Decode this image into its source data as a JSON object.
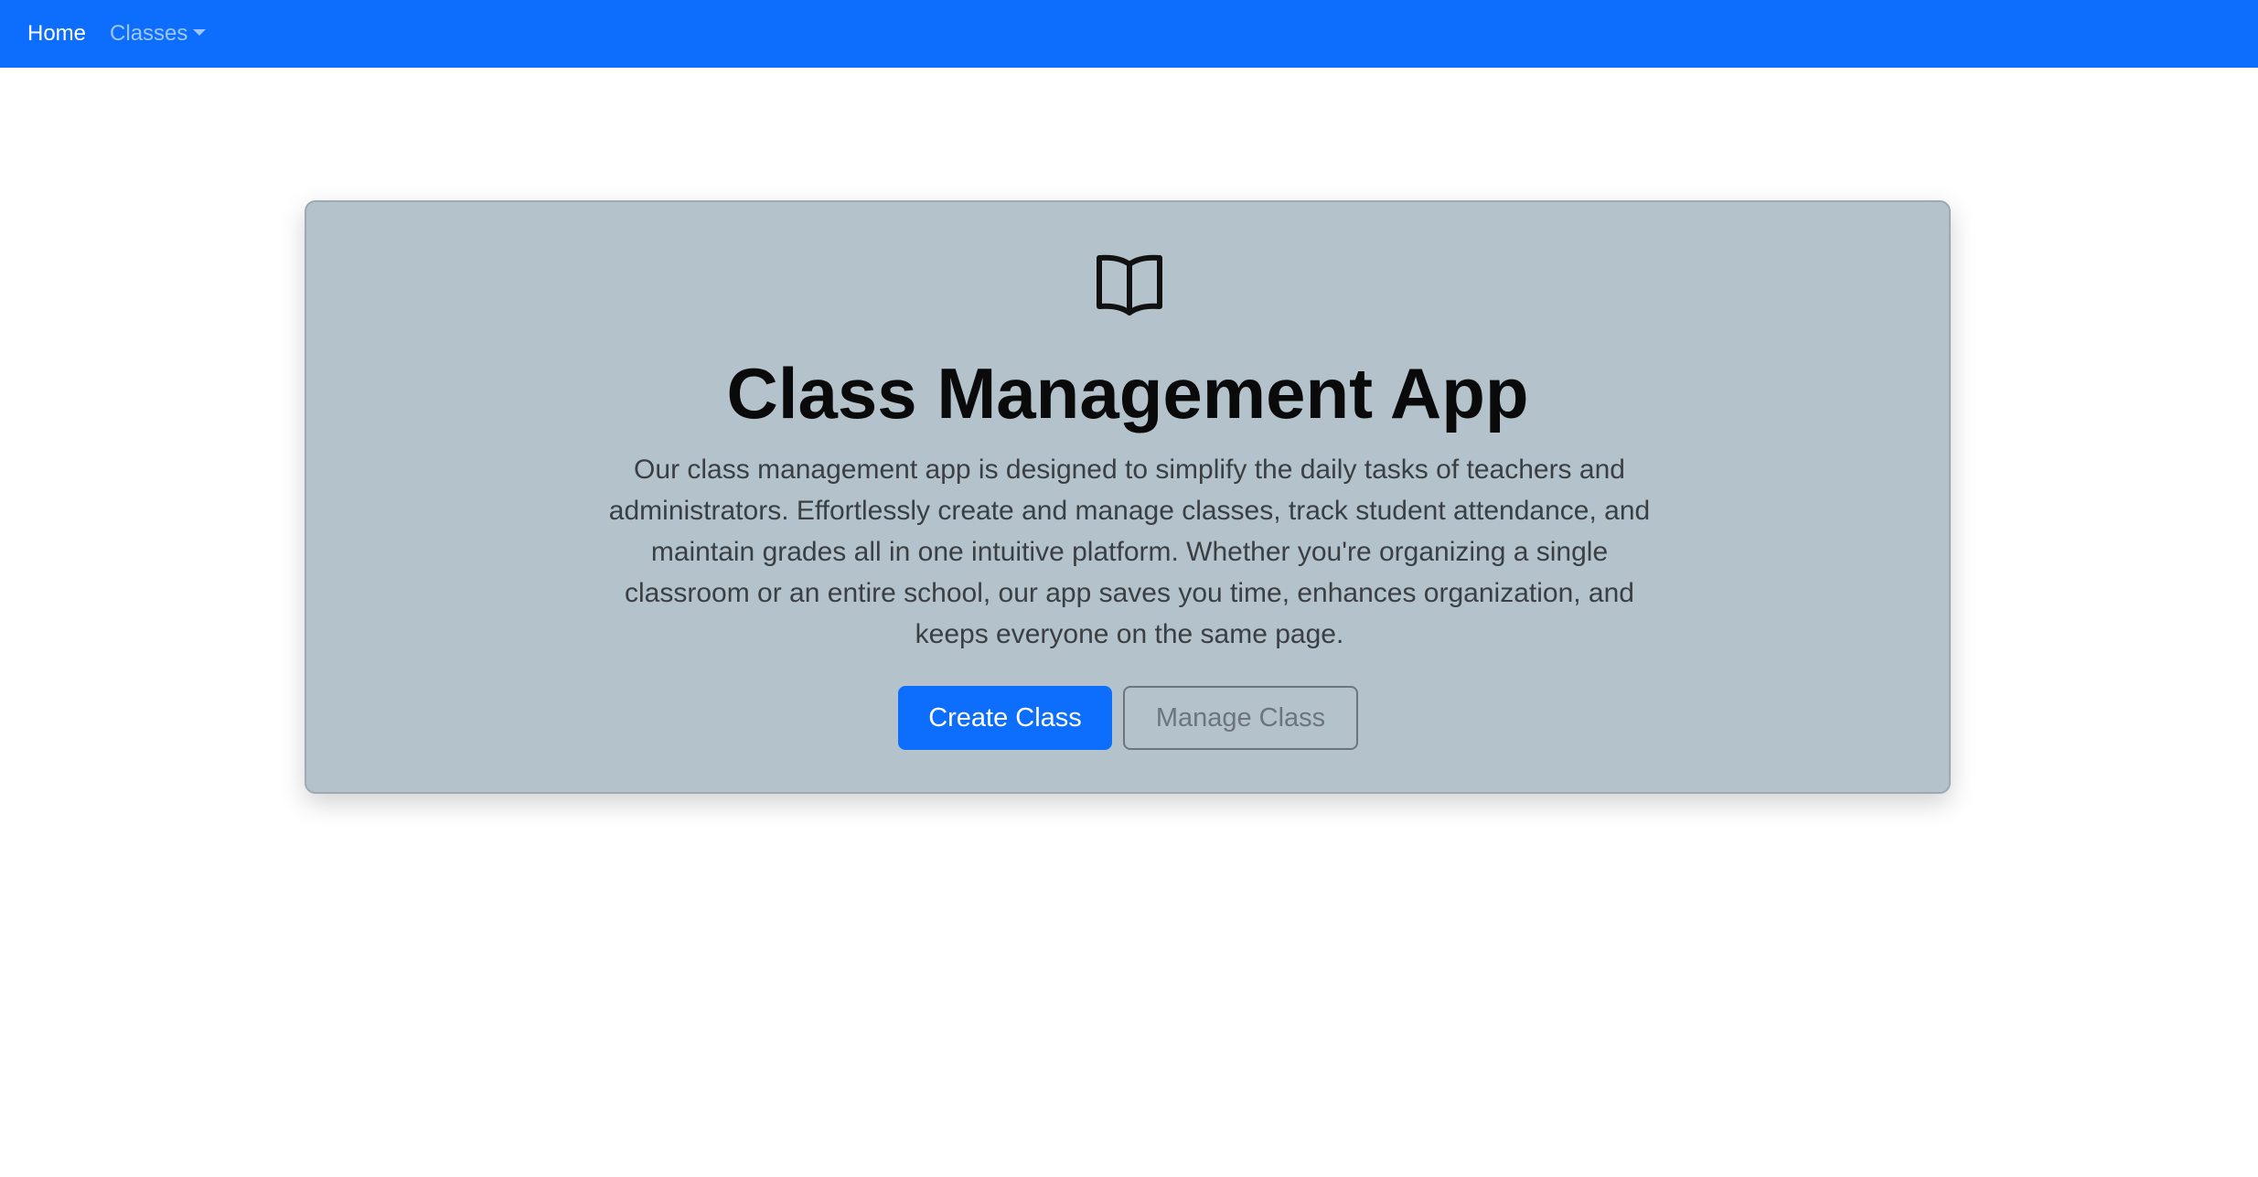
{
  "navbar": {
    "home_label": "Home",
    "classes_label": "Classes",
    "brand_color": "#0d6efd"
  },
  "hero": {
    "icon": "book-icon",
    "title": "Class Management App",
    "description": "Our class management app is designed to simplify the daily tasks of teachers and administrators. Effortlessly create and manage classes, track student attendance, and maintain grades all in one intuitive platform. Whether you're organizing a single classroom or an entire school, our app saves you time, enhances organization, and keeps everyone on the same page.",
    "primary_button_label": "Create Class",
    "secondary_button_label": "Manage Class",
    "background_color": "#b4c2cb"
  }
}
